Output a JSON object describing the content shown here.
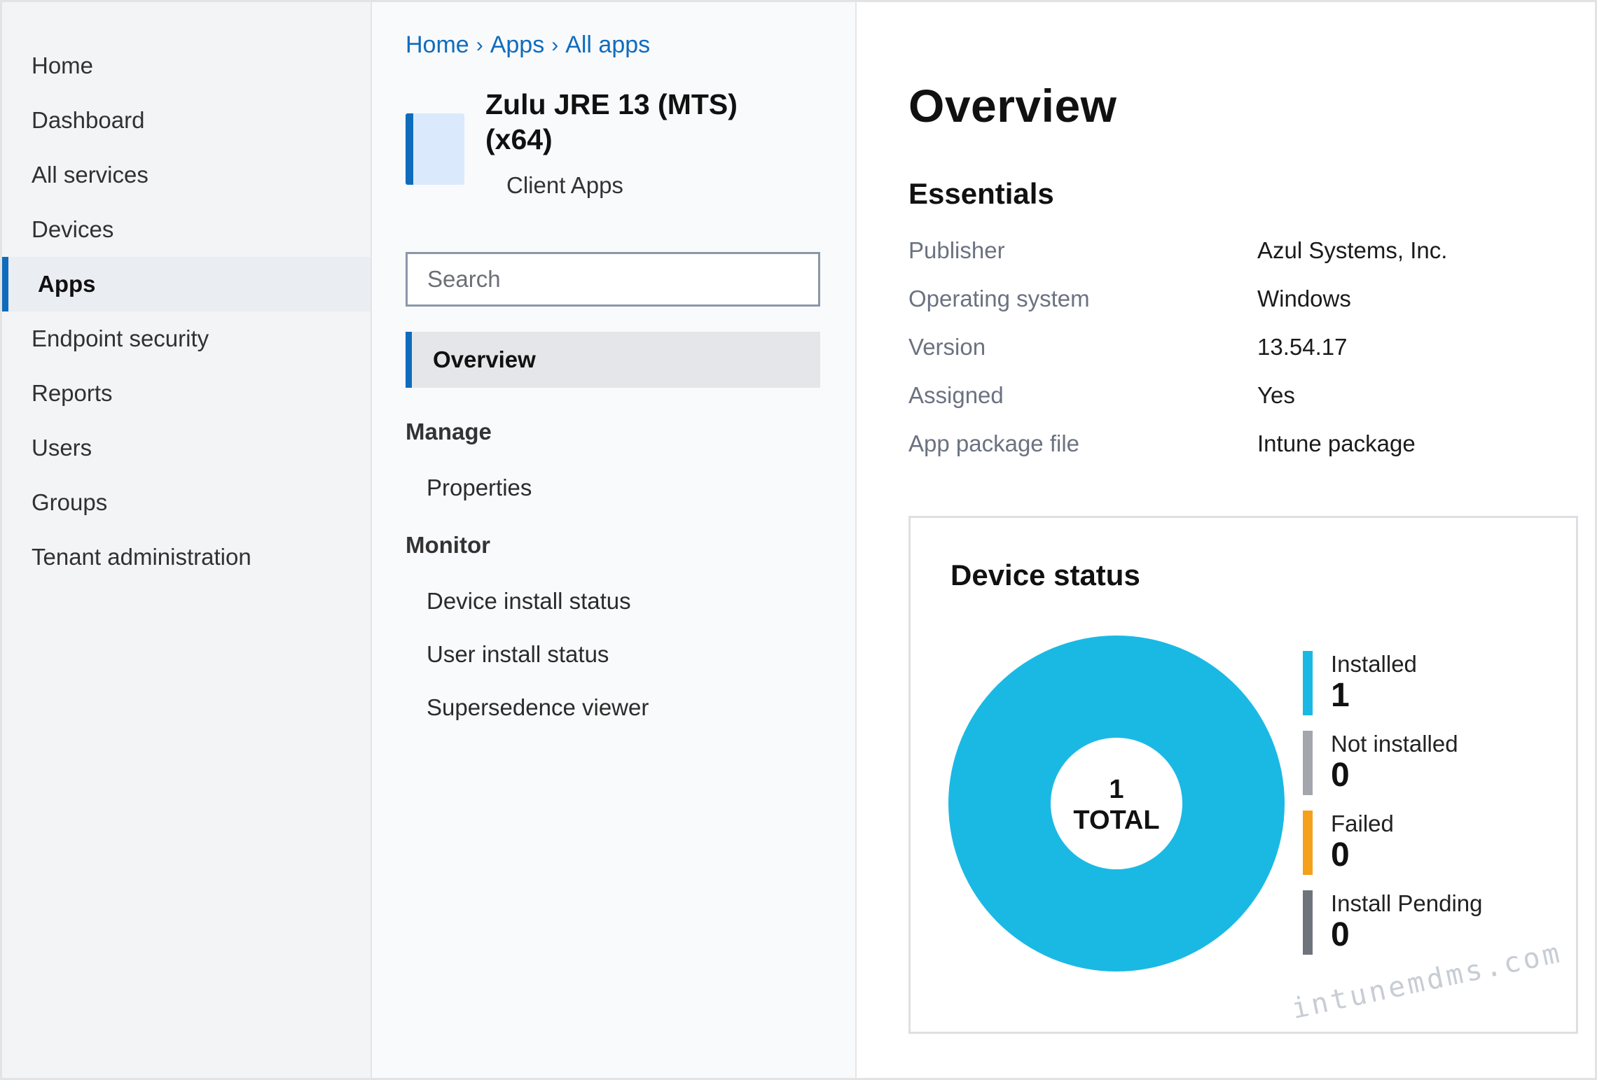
{
  "nav": {
    "items": [
      {
        "label": "Home",
        "active": false
      },
      {
        "label": "Dashboard",
        "active": false
      },
      {
        "label": "All services",
        "active": false
      },
      {
        "label": "Devices",
        "active": false
      },
      {
        "label": "Apps",
        "active": true
      },
      {
        "label": "Endpoint security",
        "active": false
      },
      {
        "label": "Reports",
        "active": false
      },
      {
        "label": "Users",
        "active": false
      },
      {
        "label": "Groups",
        "active": false
      },
      {
        "label": "Tenant administration",
        "active": false
      }
    ]
  },
  "breadcrumb": [
    "Home",
    "Apps",
    "All apps"
  ],
  "app": {
    "name": "Zulu JRE 13 (MTS) (x64)",
    "subtitle": "Client Apps"
  },
  "menu": {
    "search_placeholder": "Search",
    "active_item": "Overview",
    "groups": [
      {
        "title": "Manage",
        "items": [
          "Properties"
        ]
      },
      {
        "title": "Monitor",
        "items": [
          "Device install status",
          "User install status",
          "Supersedence viewer"
        ]
      }
    ]
  },
  "content": {
    "title": "Overview",
    "essentials_title": "Essentials",
    "essentials": [
      {
        "key": "Publisher",
        "value": "Azul Systems, Inc."
      },
      {
        "key": "Operating system",
        "value": "Windows"
      },
      {
        "key": "Version",
        "value": "13.54.17"
      },
      {
        "key": "Assigned",
        "value": "Yes"
      },
      {
        "key": "App package file",
        "value": "Intune package"
      }
    ]
  },
  "device_status": {
    "title": "Device status",
    "total_value": "1",
    "total_label": "TOTAL",
    "legend": [
      {
        "label": "Installed",
        "value": 1,
        "color": "#1ab9e4"
      },
      {
        "label": "Not installed",
        "value": 0,
        "color": "#a3a6ad"
      },
      {
        "label": "Failed",
        "value": 0,
        "color": "#f5a01a"
      },
      {
        "label": "Install Pending",
        "value": 0,
        "color": "#6f737c"
      }
    ]
  },
  "watermark": "intunemdms.com"
}
